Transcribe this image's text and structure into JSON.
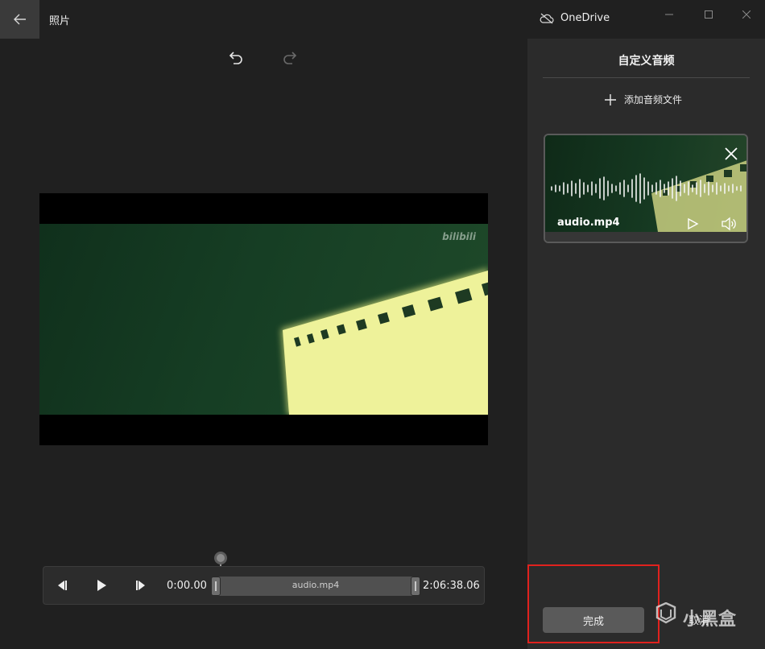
{
  "titlebar": {
    "app_name": "照片",
    "onedrive_label": "OneDrive"
  },
  "video": {
    "watermark": "bilibili"
  },
  "player": {
    "start_time": "0:00.00",
    "end_time": "2:06:38.06",
    "track_label": "audio.mp4"
  },
  "panel": {
    "title": "自定义音频",
    "add_audio_label": "添加音频文件",
    "audio_file": {
      "name": "audio.mp4"
    }
  },
  "footer": {
    "done_label": "完成",
    "cancel_label": "取消"
  },
  "overlay": {
    "brand_text": "小黑盒"
  },
  "colors": {
    "highlight": "#e0221e",
    "panel_bg": "#2b2b2b",
    "app_bg": "#202020",
    "film": "#eef29a"
  }
}
